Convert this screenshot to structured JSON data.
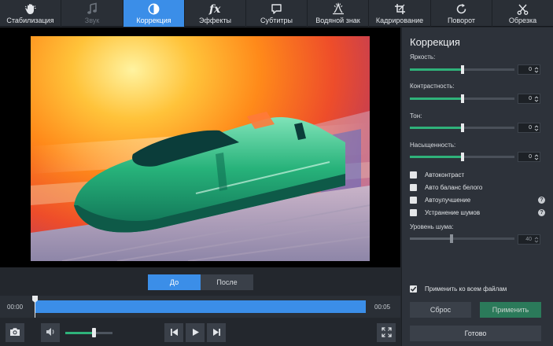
{
  "toolbar": {
    "tools": [
      {
        "label": "Стабилизация",
        "icon": "hand-icon",
        "state": "normal"
      },
      {
        "label": "Звук",
        "icon": "music-note-icon",
        "state": "disabled"
      },
      {
        "label": "Коррекция",
        "icon": "contrast-icon",
        "state": "active"
      },
      {
        "label": "Эффекты",
        "icon": "fx-icon",
        "state": "normal"
      },
      {
        "label": "Субтитры",
        "icon": "speech-bubble-icon",
        "state": "normal"
      },
      {
        "label": "Водяной знак",
        "icon": "watermark-icon",
        "state": "normal"
      },
      {
        "label": "Кадрирование",
        "icon": "crop-icon",
        "state": "normal"
      },
      {
        "label": "Поворот",
        "icon": "rotate-icon",
        "state": "normal"
      },
      {
        "label": "Обрезка",
        "icon": "scissors-icon",
        "state": "normal"
      }
    ]
  },
  "preview": {
    "before_label": "До",
    "after_label": "После",
    "selected": "before"
  },
  "timeline": {
    "start_time": "00:00",
    "end_time": "00:05",
    "progress": 0.0
  },
  "playback": {
    "volume": 0.6
  },
  "panel": {
    "title": "Коррекция",
    "sliders": [
      {
        "label": "Яркость:",
        "value": "0",
        "level": 0.5
      },
      {
        "label": "Контрастность:",
        "value": "0",
        "level": 0.5
      },
      {
        "label": "Тон:",
        "value": "0",
        "level": 0.5
      },
      {
        "label": "Насыщенность:",
        "value": "0",
        "level": 0.5
      }
    ],
    "checkboxes": [
      {
        "label": "Автоконтраст",
        "checked": false,
        "help": false
      },
      {
        "label": "Авто баланс белого",
        "checked": false,
        "help": false
      },
      {
        "label": "Автоулучшение",
        "checked": false,
        "help": true
      },
      {
        "label": "Устранение шумов",
        "checked": false,
        "help": true
      }
    ],
    "noise": {
      "label": "Уровень шума:",
      "value": "40",
      "level": 0.4,
      "enabled": false
    },
    "apply_all": {
      "label": "Применить ко всем файлам",
      "checked": true
    },
    "reset_label": "Сброс",
    "apply_label": "Применить",
    "done_label": "Готово"
  },
  "colors": {
    "accent": "#3b8ee8",
    "slider_fill": "#2fb27a",
    "apply_button": "#2b7a5a",
    "panel_bg": "#2d323a",
    "toolbar_bg": "#2a2f36"
  }
}
